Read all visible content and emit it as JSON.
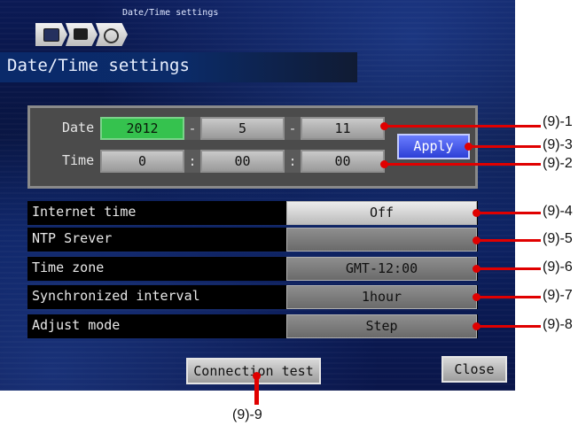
{
  "header": {
    "tab_label": "Date/Time settings",
    "title": "Date/Time settings"
  },
  "tabs": [
    {
      "icon": "monitor-icon"
    },
    {
      "icon": "device-icon"
    },
    {
      "icon": "clock-icon"
    }
  ],
  "date": {
    "label": "Date",
    "year": "2012",
    "month": "5",
    "day": "11",
    "separator": "-"
  },
  "time": {
    "label": "Time",
    "hour": "0",
    "minute": "00",
    "second": "00",
    "separator": ":"
  },
  "apply_label": "Apply",
  "settings": [
    {
      "label": "Internet time",
      "value": "Off"
    },
    {
      "label": "NTP Srever",
      "value": ""
    },
    {
      "label": "Time zone",
      "value": "GMT-12:00"
    },
    {
      "label": "Synchronized interval",
      "value": "1hour"
    },
    {
      "label": "Adjust mode",
      "value": "Step"
    }
  ],
  "buttons": {
    "connection_test": "Connection test",
    "close": "Close"
  },
  "callouts": {
    "c1": "(9)-1",
    "c2": "(9)-2",
    "c3": "(9)-3",
    "c4": "(9)-4",
    "c5": "(9)-5",
    "c6": "(9)-6",
    "c7": "(9)-7",
    "c8": "(9)-8",
    "c9": "(9)-9"
  },
  "colors": {
    "accent_green": "#35c24e",
    "apply_blue": "#3a4cf0",
    "callout_red": "#e00000"
  }
}
